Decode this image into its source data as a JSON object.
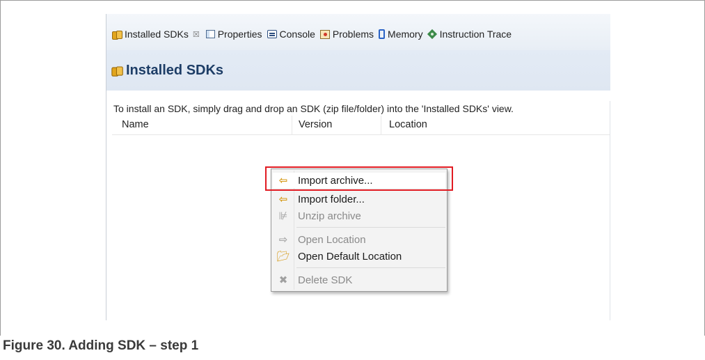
{
  "tabs": [
    {
      "label": "Installed SDKs",
      "icon": "sdk-icon"
    },
    {
      "label": "Properties",
      "icon": "properties-icon"
    },
    {
      "label": "Console",
      "icon": "console-icon"
    },
    {
      "label": "Problems",
      "icon": "problems-icon"
    },
    {
      "label": "Memory",
      "icon": "memory-icon"
    },
    {
      "label": "Instruction Trace",
      "icon": "trace-icon"
    }
  ],
  "tab_close": "☒",
  "view": {
    "title": "Installed SDKs",
    "description": "To install an SDK, simply drag and drop an SDK (zip file/folder) into the 'Installed SDKs' view.",
    "columns": [
      "Name",
      "Version",
      "Location"
    ]
  },
  "context_menu": {
    "items": [
      {
        "label": "Import archive...",
        "icon": "import-arrow-icon",
        "enabled": true,
        "highlighted": true
      },
      {
        "label": "Import folder...",
        "icon": "import-arrow-icon",
        "enabled": true
      },
      {
        "label": "Unzip archive",
        "icon": "zip-icon",
        "enabled": false
      },
      {
        "label": "Open Location",
        "icon": "open-arrow-icon",
        "enabled": false
      },
      {
        "label": "Open Default Location",
        "icon": "folder-icon",
        "enabled": true
      },
      {
        "label": "Delete SDK",
        "icon": "delete-icon",
        "enabled": false
      }
    ]
  },
  "caption": "Figure 30.  Adding SDK – step 1",
  "colors": {
    "highlight_border": "#e11b22",
    "title_text": "#1d3d66",
    "header_bg": "#e3ebf5"
  }
}
